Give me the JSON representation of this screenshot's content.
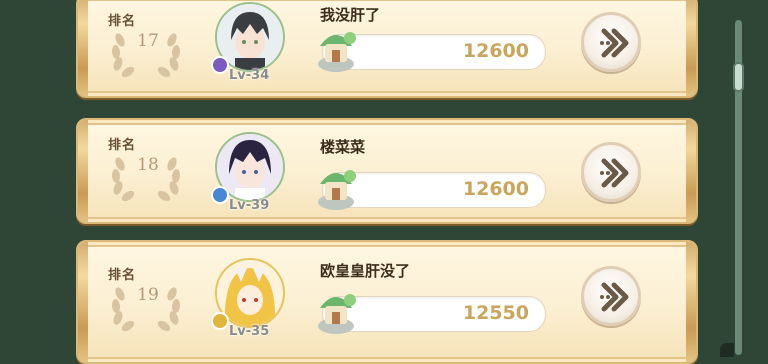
{
  "rows": [
    {
      "rank_label": "排名",
      "rank": "17",
      "name": "我没肝了",
      "level": "Lv-34",
      "score": "12600",
      "badge_color": "#7b5bc2",
      "avatar_hair": "#3a3d42",
      "avatar_skin": "#f7e2d4"
    },
    {
      "rank_label": "排名",
      "rank": "18",
      "name": "楼菜菜",
      "level": "Lv-39",
      "score": "12600",
      "badge_color": "#4a86d6",
      "avatar_hair": "#2b2440",
      "avatar_skin": "#f8e6dc"
    },
    {
      "rank_label": "排名",
      "rank": "19",
      "name": "欧皇皇肝没了",
      "level": "Lv-35",
      "score": "12550",
      "badge_color": "#e2b63a",
      "avatar_hair": "#f1c445",
      "avatar_skin": "#fbeedd"
    }
  ],
  "colors": {
    "background": "#2f4636",
    "score": "#c9a65b",
    "name": "#3d2d1c"
  },
  "icons": {
    "go": "double-chevron-right-icon",
    "laurel": "laurel-icon",
    "house": "house-score-icon"
  }
}
